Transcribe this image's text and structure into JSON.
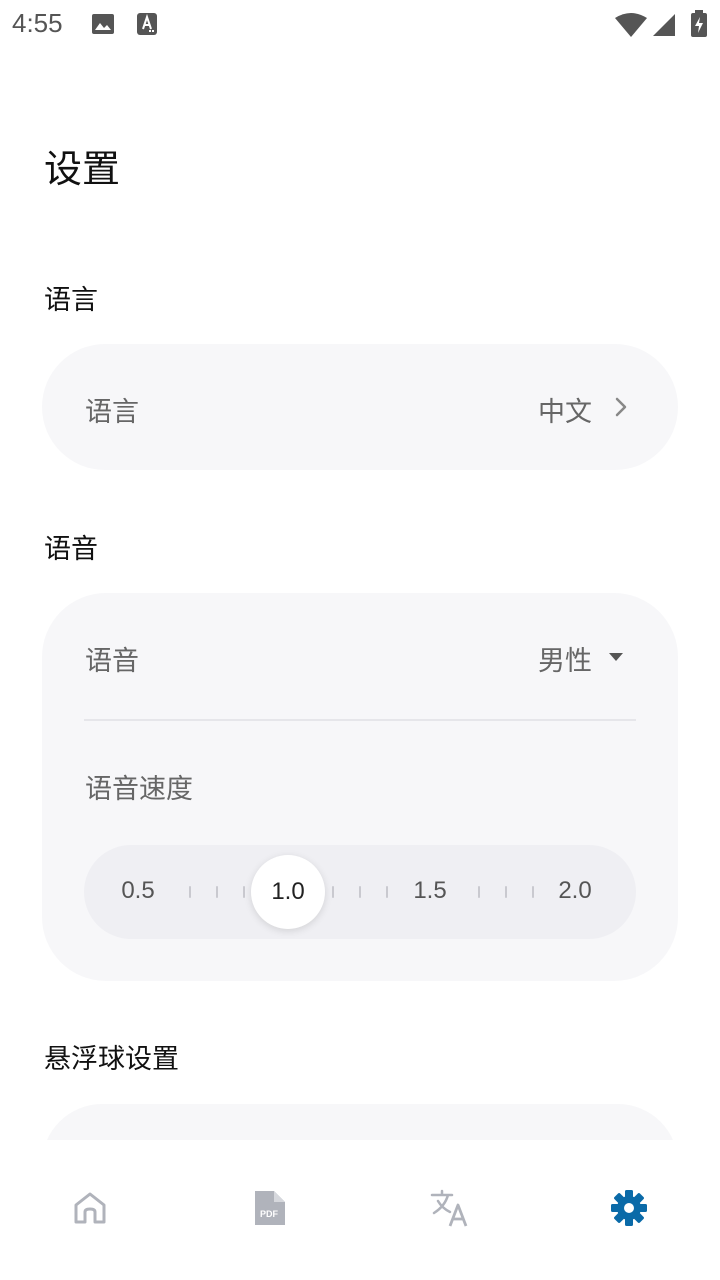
{
  "status_bar": {
    "time": "4:55"
  },
  "page": {
    "title": "设置"
  },
  "language_section": {
    "title": "语言",
    "row_label": "语言",
    "row_value": "中文"
  },
  "voice_section": {
    "title": "语音",
    "voice_label": "语音",
    "voice_value": "男性",
    "speed_label": "语音速度",
    "speed": {
      "options": [
        "0.5",
        "1.0",
        "1.5",
        "2.0"
      ],
      "selected": "1.0"
    }
  },
  "float_section": {
    "title": "悬浮球设置"
  },
  "colors": {
    "accent": "#0a6aa8",
    "nav_inactive": "#b0b3bb",
    "card_bg": "#f7f7f9"
  },
  "bottom_nav": [
    {
      "name": "home-icon",
      "active": false
    },
    {
      "name": "pdf-icon",
      "active": false
    },
    {
      "name": "translate-icon",
      "active": false
    },
    {
      "name": "settings-icon",
      "active": true
    }
  ]
}
